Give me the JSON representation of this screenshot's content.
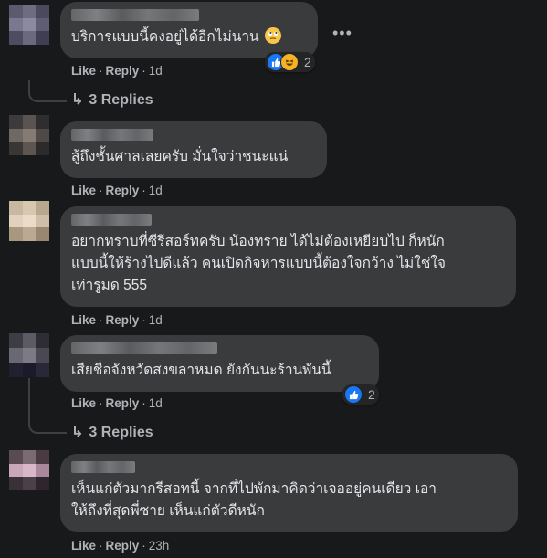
{
  "comments": [
    {
      "text": "บริการแบบนี้คงอยู่ได้อีกไม่นาน",
      "like": "Like",
      "reply": "Reply",
      "time": "1d",
      "reactions": "2",
      "replies": "3 Replies"
    },
    {
      "text": "สู้ถึงชั้นศาลเลยครับ มั่นใจว่าชนะแน่",
      "like": "Like",
      "reply": "Reply",
      "time": "1d"
    },
    {
      "text_lines": [
        "อยากทราบที่ซีรีสอร์ทครับ น้องทราย ได้ไม่ต้องเหยียบไป ก็หนัก",
        "แบบนี้ให้ร้างไปดีแล้ว คนเปิดกิจหารแบบนี้ต้องใจกว้าง ไม่ใช่ใจ",
        "เท่ารูมด 555"
      ],
      "like": "Like",
      "reply": "Reply",
      "time": "1d"
    },
    {
      "text": "เสียชื่อจังหวัดสงขลาหมด ยังกันนะร้านพันนี้",
      "like": "Like",
      "reply": "Reply",
      "time": "1d",
      "reactions": "2",
      "replies": "3 Replies"
    },
    {
      "text_lines": [
        "เห็นแก่ตัวมากรีสอทนี้ จากที่ไปพักมาคิดว่าเจออยู่คนเดียว เอา",
        "ให้ถึงที่สุดพี่ซาย เห็นแก่ตัวดีหนัก"
      ],
      "like": "Like",
      "reply": "Reply",
      "time": "23h"
    }
  ],
  "icons": {
    "more": "more-horizontal-icon",
    "like_reaction": "like-reaction-icon",
    "haha_reaction": "haha-reaction-icon",
    "reply_arrow": "reply-arrow-icon",
    "emoji": "rolling-eyes-emoji"
  },
  "colors": {
    "background": "#18191a",
    "bubble": "#3a3b3c",
    "secondary_text": "#b0b3b8",
    "like_blue": "#1877f2"
  }
}
